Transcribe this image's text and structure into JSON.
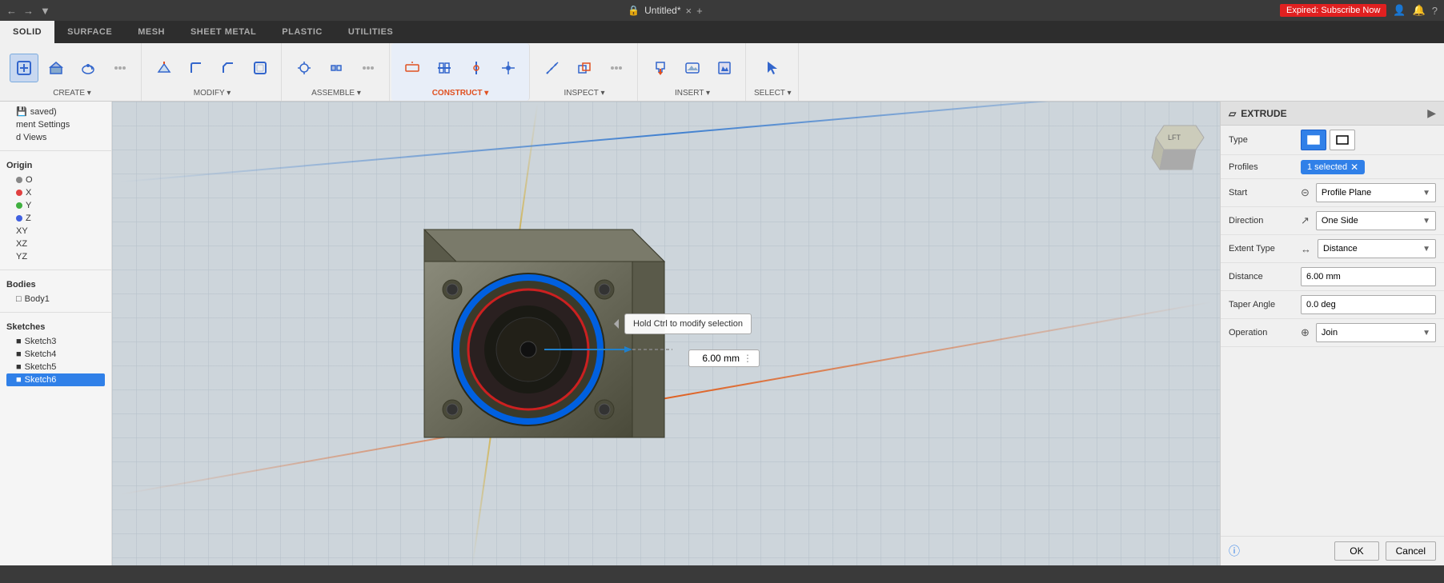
{
  "window": {
    "title": "Untitled*",
    "close_label": "×",
    "add_label": "+",
    "subscribe_label": "Expired: Subscribe Now"
  },
  "tabs": [
    {
      "id": "solid",
      "label": "SOLID",
      "active": true
    },
    {
      "id": "surface",
      "label": "SURFACE"
    },
    {
      "id": "mesh",
      "label": "MESH"
    },
    {
      "id": "sheet_metal",
      "label": "SHEET METAL"
    },
    {
      "id": "plastic",
      "label": "PLASTIC"
    },
    {
      "id": "utilities",
      "label": "UTILITIES"
    }
  ],
  "toolbar_groups": [
    {
      "label": "CREATE ▾",
      "icons": [
        "⊕",
        "□",
        "⊙",
        "★"
      ]
    },
    {
      "label": "MODIFY ▾",
      "icons": [
        "✎",
        "⊞",
        "◎",
        "⊿"
      ]
    },
    {
      "label": "ASSEMBLE ▾",
      "icons": [
        "⚙",
        "⊕",
        "▣"
      ]
    },
    {
      "label": "CONSTRUCT ▾",
      "icons": [
        "◈",
        "▷",
        "⊕",
        "◻"
      ],
      "highlighted": true
    },
    {
      "label": "INSPECT ▾",
      "icons": [
        "🔍",
        "📐",
        "⊕"
      ]
    },
    {
      "label": "INSERT ▾",
      "icons": [
        "⬇",
        "↩",
        "🖼"
      ]
    },
    {
      "label": "SELECT ▾",
      "icons": [
        "↖"
      ]
    }
  ],
  "sidebar": {
    "sections": [
      {
        "title": "",
        "items": [
          {
            "label": "saved)",
            "icon": "💾",
            "indent": 0
          },
          {
            "label": "ment Settings",
            "indent": 0
          },
          {
            "label": "d Views",
            "indent": 0
          }
        ]
      },
      {
        "title": "Origin",
        "items": [
          {
            "label": "O",
            "indent": 1
          },
          {
            "label": "X",
            "indent": 1
          },
          {
            "label": "Y",
            "indent": 1
          },
          {
            "label": "Z",
            "indent": 1
          },
          {
            "label": "XY",
            "indent": 1
          },
          {
            "label": "XZ",
            "indent": 1
          },
          {
            "label": "YZ",
            "indent": 1
          }
        ]
      },
      {
        "title": "Bodies",
        "items": [
          {
            "label": "Body1",
            "indent": 1
          }
        ]
      },
      {
        "title": "Sketches",
        "items": [
          {
            "label": "Sketch3",
            "indent": 1
          },
          {
            "label": "Sketch4",
            "indent": 1
          },
          {
            "label": "Sketch5",
            "indent": 1
          },
          {
            "label": "Sketch6",
            "indent": 1,
            "active": true
          }
        ]
      }
    ]
  },
  "viewport": {
    "callout_text": "Hold Ctrl to modify selection",
    "distance_value": "6.00 mm"
  },
  "panel": {
    "title": "EXTRUDE",
    "info_icon": "ℹ",
    "rows": [
      {
        "label": "Type",
        "type": "type-buttons",
        "buttons": [
          {
            "icon": "▣",
            "active": true,
            "title": "Solid"
          },
          {
            "icon": "◻",
            "active": false,
            "title": "Surface"
          }
        ]
      },
      {
        "label": "Profiles",
        "type": "selected-badge",
        "badge_text": "1 selected",
        "show_x": true
      },
      {
        "label": "Start",
        "type": "dropdown",
        "icon": "⊡",
        "value": "Profile Plane"
      },
      {
        "label": "Direction",
        "type": "dropdown",
        "icon": "↗",
        "value": "One Side"
      },
      {
        "label": "Extent Type",
        "type": "dropdown",
        "icon": "↔",
        "value": "Distance"
      },
      {
        "label": "Distance",
        "type": "text",
        "value": "6.00 mm"
      },
      {
        "label": "Taper Angle",
        "type": "text",
        "value": "0.0 deg"
      },
      {
        "label": "Operation",
        "type": "dropdown",
        "icon": "⊕",
        "value": "Join"
      }
    ],
    "ok_label": "OK",
    "cancel_label": "Cancel"
  },
  "navcube": {
    "label": "LFT"
  },
  "status_bar": {
    "text": ""
  }
}
